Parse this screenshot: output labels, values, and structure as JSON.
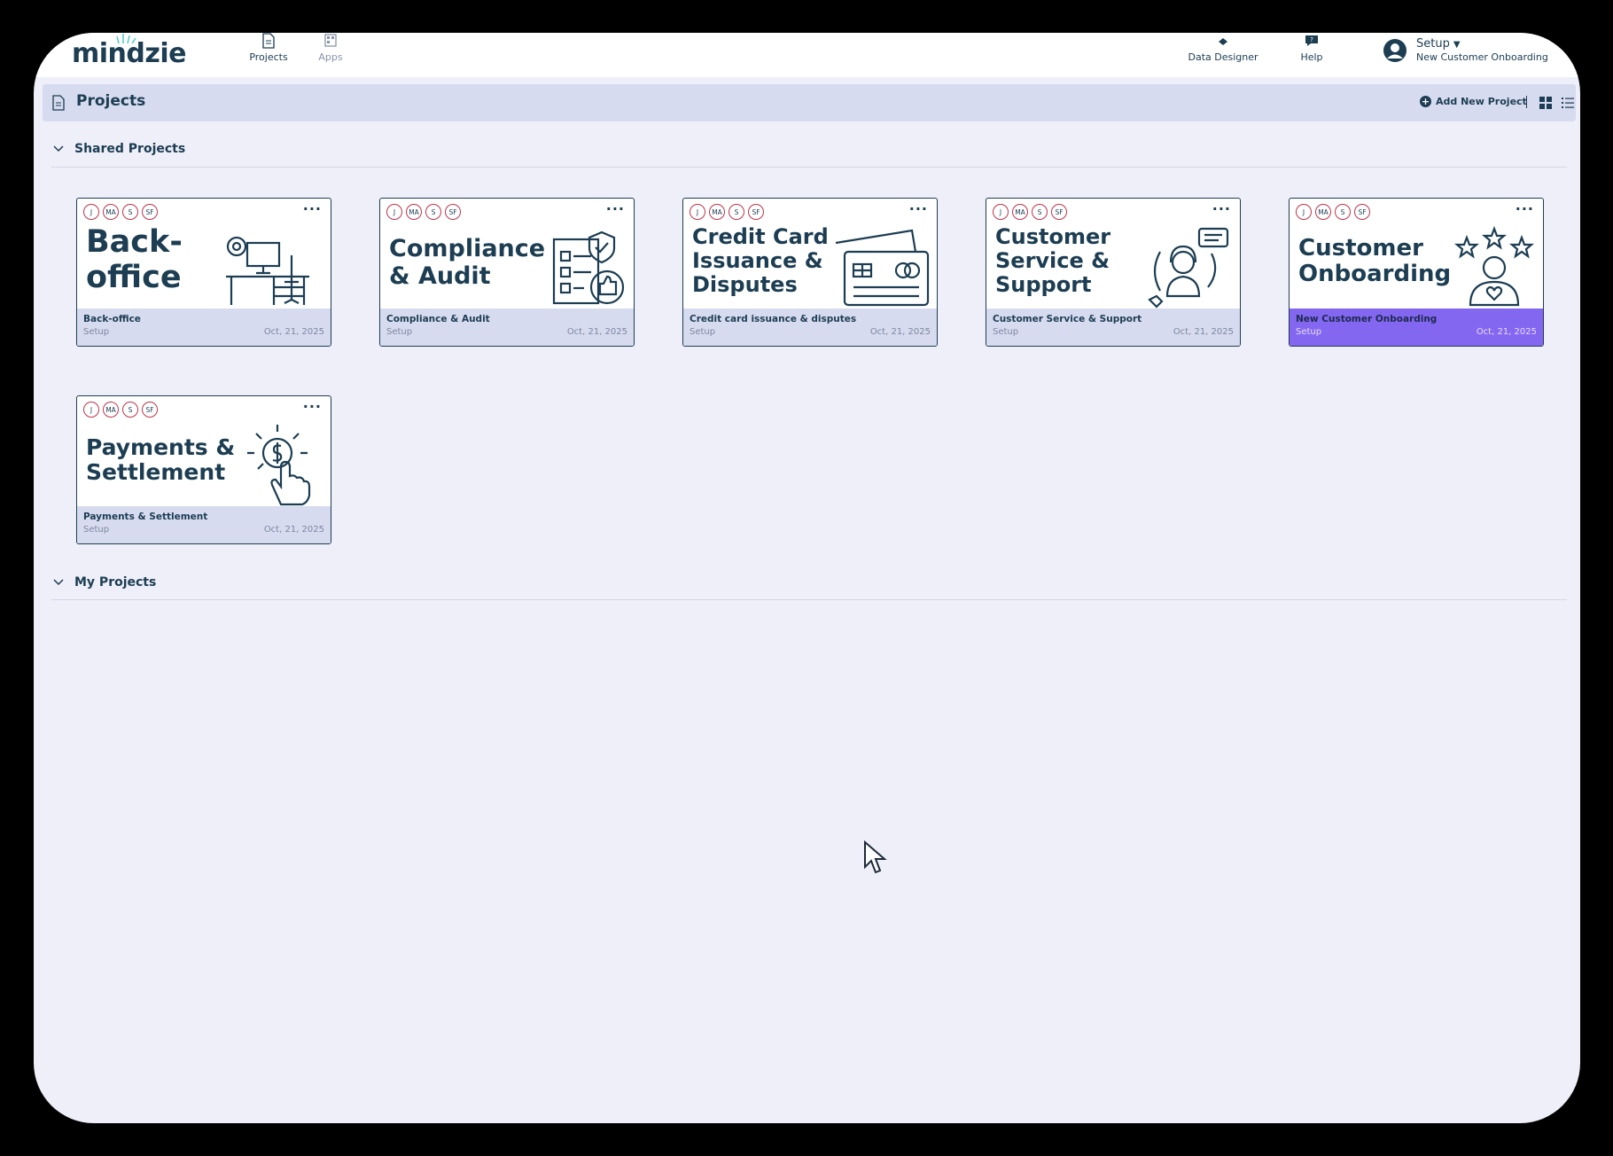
{
  "app": {
    "logo": "mindzie"
  },
  "nav": {
    "items": [
      {
        "label": "Projects",
        "icon": "document-icon"
      },
      {
        "label": "Apps",
        "icon": "apps-icon"
      }
    ],
    "right": [
      {
        "label": "Data Designer",
        "icon": "data-designer-icon"
      },
      {
        "label": "Help",
        "icon": "help-chat-icon"
      }
    ],
    "user": {
      "name": "Setup",
      "tenant": "New Customer Onboarding"
    }
  },
  "header": {
    "title": "Projects",
    "add_label": "Add New Project"
  },
  "sections": {
    "shared": "Shared Projects",
    "mine": "My Projects"
  },
  "badges": [
    "J",
    "MA",
    "S",
    "SF"
  ],
  "cards": [
    {
      "cover": [
        "Back-",
        "office"
      ],
      "name": "Back-office",
      "owner": "Setup",
      "date": "Oct, 21, 2025",
      "icon": "office-desk-icon"
    },
    {
      "cover": [
        "Compliance",
        "& Audit"
      ],
      "name": "Compliance & Audit",
      "owner": "Setup",
      "date": "Oct, 21, 2025",
      "icon": "checklist-shield-icon"
    },
    {
      "cover": [
        "Credit Card",
        "Issuance &",
        "Disputes"
      ],
      "name": "Credit card issuance & disputes",
      "owner": "Setup",
      "date": "Oct, 21, 2025",
      "icon": "credit-card-icon"
    },
    {
      "cover": [
        "Customer",
        "Service &",
        "Support"
      ],
      "name": "Customer Service & Support",
      "owner": "Setup",
      "date": "Oct, 21, 2025",
      "icon": "support-agent-icon"
    },
    {
      "cover": [
        "Customer",
        "Onboarding"
      ],
      "name": "New Customer Onboarding",
      "owner": "Setup",
      "date": "Oct, 21, 2025",
      "icon": "customer-stars-icon",
      "active": true
    },
    {
      "cover": [
        "Payments &",
        "Settlement"
      ],
      "name": "Payments & Settlement",
      "owner": "Setup",
      "date": "Oct, 21, 2025",
      "icon": "payment-click-icon"
    }
  ],
  "colors": {
    "primary": "#1c3d52",
    "accent": "#8467f0",
    "header_bg": "#d7dbf0",
    "page_bg": "#efeff9",
    "badge_ring": "#c0334a"
  }
}
